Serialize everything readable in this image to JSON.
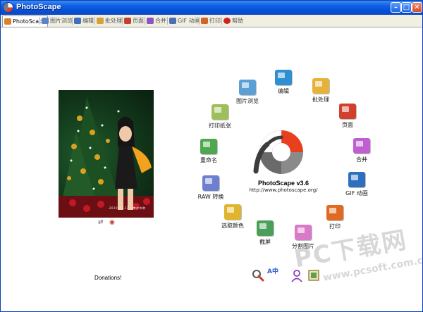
{
  "window": {
    "title": "PhotoScape",
    "controls": {
      "minimize": "–",
      "maximize": "□",
      "close": "✕"
    }
  },
  "tabs": [
    {
      "label": "PhotoScape",
      "icon": "photoscape-icon",
      "color": "#d9822b",
      "active": true
    },
    {
      "label": "图片浏览",
      "icon": "viewer-icon",
      "color": "#5a84c8",
      "active": false
    },
    {
      "label": "编辑",
      "icon": "editor-icon",
      "color": "#3f6fc0",
      "active": false
    },
    {
      "label": "批处理",
      "icon": "batch-icon",
      "color": "#d5a23a",
      "active": false
    },
    {
      "label": "页面",
      "icon": "page-icon",
      "color": "#c2402f",
      "active": false
    },
    {
      "label": "合并",
      "icon": "combine-icon",
      "color": "#8b55c2",
      "active": false
    },
    {
      "label": "GIF 动画",
      "icon": "gif-icon",
      "color": "#4a6fb2",
      "active": false
    },
    {
      "label": "打印",
      "icon": "print-icon",
      "color": "#d2642a",
      "active": false
    },
    {
      "label": "帮助",
      "icon": "help-icon",
      "color": "#cc2222",
      "active": false
    }
  ],
  "photo": {
    "caption": "2010.12.17 · 南京东路",
    "controls": [
      "⇄",
      "◉"
    ]
  },
  "center": {
    "app_name": "PhotoScape v3.6",
    "url": "http://www.photoscape.org/",
    "logo_colors": {
      "accent": "#e8401f",
      "gray": "#7a7a7a",
      "dark": "#3c3c3c"
    }
  },
  "modules": [
    {
      "label": "编辑",
      "icon": "editor-icon",
      "color": "#2f8fd0"
    },
    {
      "label": "批处理",
      "icon": "batch-icon",
      "color": "#e5b23a"
    },
    {
      "label": "页面",
      "icon": "page-icon",
      "color": "#d2402c"
    },
    {
      "label": "合并",
      "icon": "combine-icon",
      "color": "#c05fd0"
    },
    {
      "label": "GIF 动画",
      "icon": "gif-animation-icon",
      "color": "#2f6fbf"
    },
    {
      "label": "打印",
      "icon": "print-icon",
      "color": "#e06a22"
    },
    {
      "label": "分割图片",
      "icon": "splitter-icon",
      "color": "#d87ac8"
    },
    {
      "label": "截屏",
      "icon": "screen-capture-icon",
      "color": "#4aa05a"
    },
    {
      "label": "选取颜色",
      "icon": "color-picker-icon",
      "color": "#e0b52d"
    },
    {
      "label": "RAW 转换",
      "icon": "raw-converter-icon",
      "color": "#6f7fd0"
    },
    {
      "label": "重命名",
      "icon": "rename-icon",
      "color": "#4fa84f"
    },
    {
      "label": "打印纸张",
      "icon": "paper-print-icon",
      "color": "#9fbf5a"
    },
    {
      "label": "图片浏览",
      "icon": "viewer-icon",
      "color": "#5a9fd6"
    }
  ],
  "footer": {
    "donations": "Donations!",
    "icons": [
      "settings-icon",
      "language-icon",
      "user-icon",
      "frame-icon"
    ],
    "language_glyph": "A中"
  },
  "watermark": {
    "big": "PC下载网",
    "small": "www.pcsoft.com.cn"
  }
}
